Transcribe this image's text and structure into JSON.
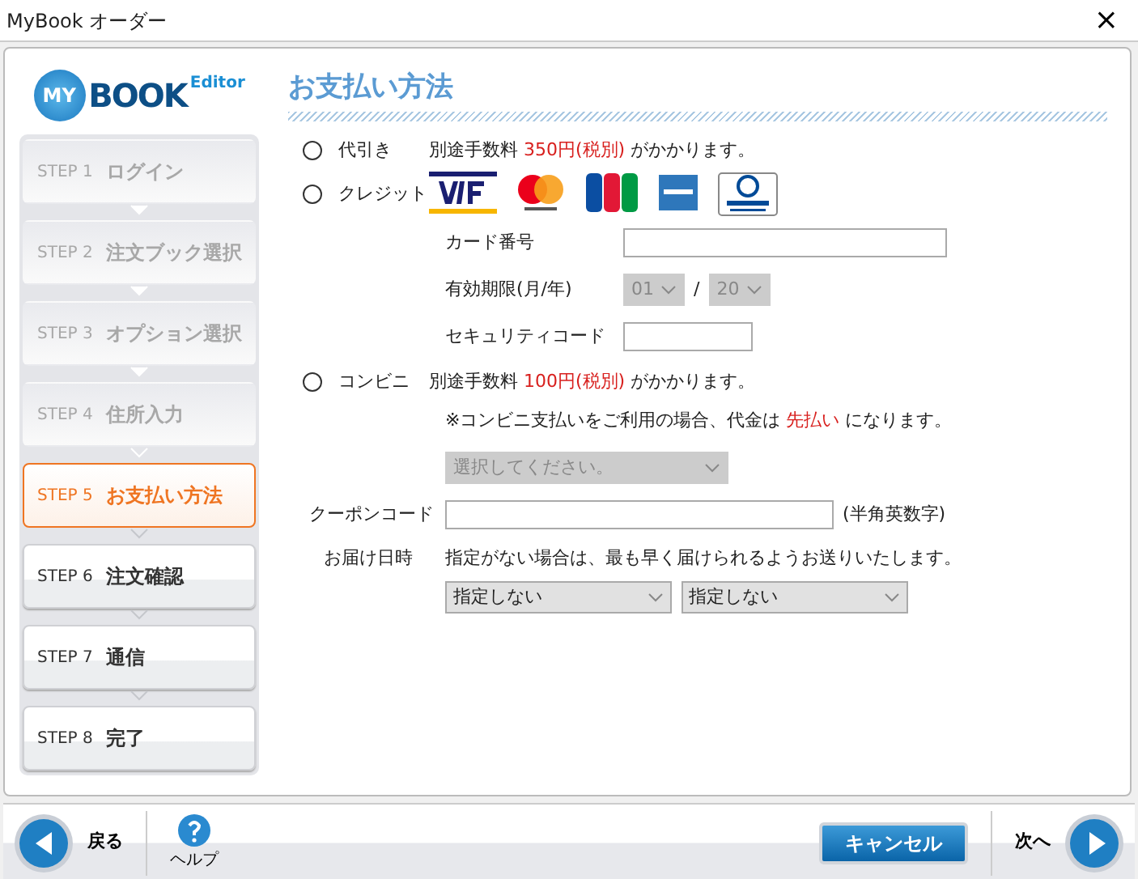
{
  "window": {
    "title": "MyBook オーダー",
    "close": "×"
  },
  "logo": {
    "main": "BOOK",
    "badge": "MY",
    "sub": "Editor"
  },
  "steps": [
    {
      "number": "STEP 1",
      "label": "ログイン",
      "completed": true,
      "selected": false
    },
    {
      "number": "STEP 2",
      "label": "注文ブック選択",
      "completed": true,
      "selected": false
    },
    {
      "number": "STEP 3",
      "label": "オプション選択",
      "completed": true,
      "selected": false
    },
    {
      "number": "STEP 4",
      "label": "住所入力",
      "completed": true,
      "selected": false
    },
    {
      "number": "STEP 5",
      "label": "お支払い方法",
      "completed": false,
      "selected": true
    },
    {
      "number": "STEP 6",
      "label": "注文確認",
      "completed": false,
      "selected": false
    },
    {
      "number": "STEP 7",
      "label": "通信",
      "completed": false,
      "selected": false
    },
    {
      "number": "STEP 8",
      "label": "完了",
      "completed": false,
      "selected": false
    }
  ],
  "page_title": "お支払い方法",
  "cod": {
    "label": "代引き",
    "checked": false,
    "note": {
      "before": "別途手数料",
      "fee": "350円(税別)",
      "after": "がかかります。"
    }
  },
  "credit": {
    "label": "クレジット",
    "checked": false,
    "brands": [
      {
        "kind": "visa"
      },
      {
        "kind": "master"
      },
      {
        "kind": "jcb"
      },
      {
        "kind": "amex"
      },
      {
        "kind": "diners"
      }
    ],
    "card_number": {
      "label": "カード番号"
    },
    "expiry": {
      "label": "有効期限(月/年)",
      "month": "01",
      "separator": "/",
      "year": "20",
      "disabled": true
    },
    "security_code": {
      "label": "セキュリティコード"
    }
  },
  "konbini": {
    "label": "コンビニ",
    "checked": false,
    "note": {
      "before": "別途手数料",
      "fee": "100円(税別)",
      "after": "がかかります。"
    },
    "notice": {
      "before": "※コンビニ支払いをご利用の場合、代金は",
      "highlight": "先払い",
      "after": "になります。"
    },
    "store_select": {
      "value": "選択してください。",
      "disabled": true
    }
  },
  "coupon": {
    "label": "クーポンコード",
    "hint": "(半角英数字)"
  },
  "delivery": {
    "label": "お届け日時",
    "note": "指定がない場合は、最も早く届けられるようお送りいたします。",
    "date_select": "指定しない",
    "time_select": "指定しない"
  },
  "footer": {
    "back": "戻る",
    "help": "ヘルプ",
    "cancel": "キャンセル",
    "next": "次へ"
  }
}
